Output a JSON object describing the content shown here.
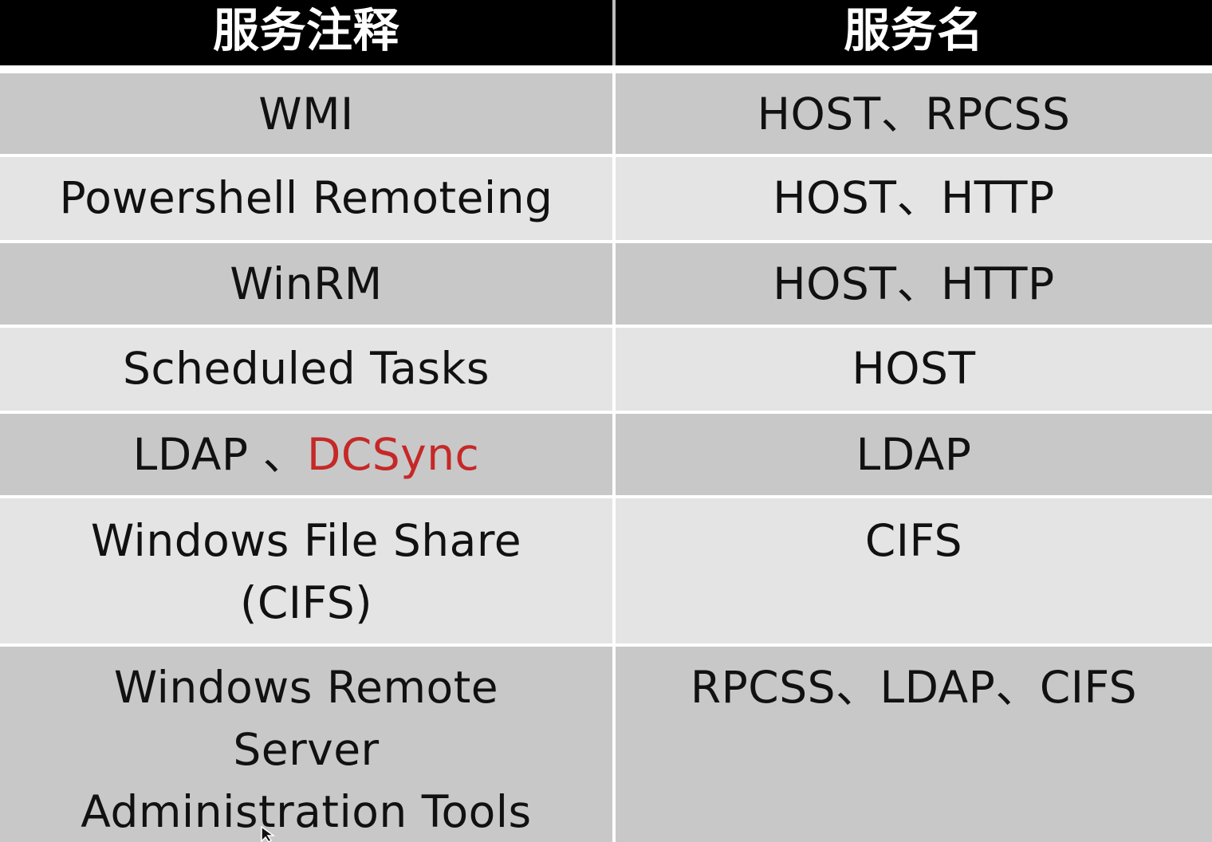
{
  "table": {
    "headers": [
      "服务注释",
      "服务名"
    ],
    "rows": [
      {
        "note": "WMI",
        "service": "HOST、RPCSS"
      },
      {
        "note": "Powershell Remoteing",
        "service": "HOST、HTTP"
      },
      {
        "note": "WinRM",
        "service": "HOST、HTTP"
      },
      {
        "note": "Scheduled Tasks",
        "service": "HOST"
      },
      {
        "note_part1": "LDAP 、",
        "note_part2": "DCSync",
        "service": "LDAP"
      },
      {
        "note_line1": "Windows File Share",
        "note_line2": "(CIFS)",
        "service": "CIFS"
      },
      {
        "note_line1": "Windows Remote",
        "note_line2": "Server",
        "note_line3": "Administration Tools",
        "service": "RPCSS、LDAP、CIFS"
      }
    ]
  },
  "colors": {
    "header_bg": "#000000",
    "header_text": "#ffffff",
    "row_dark": "#c8c8c8",
    "row_light": "#e4e4e4",
    "accent": "#c62828"
  }
}
